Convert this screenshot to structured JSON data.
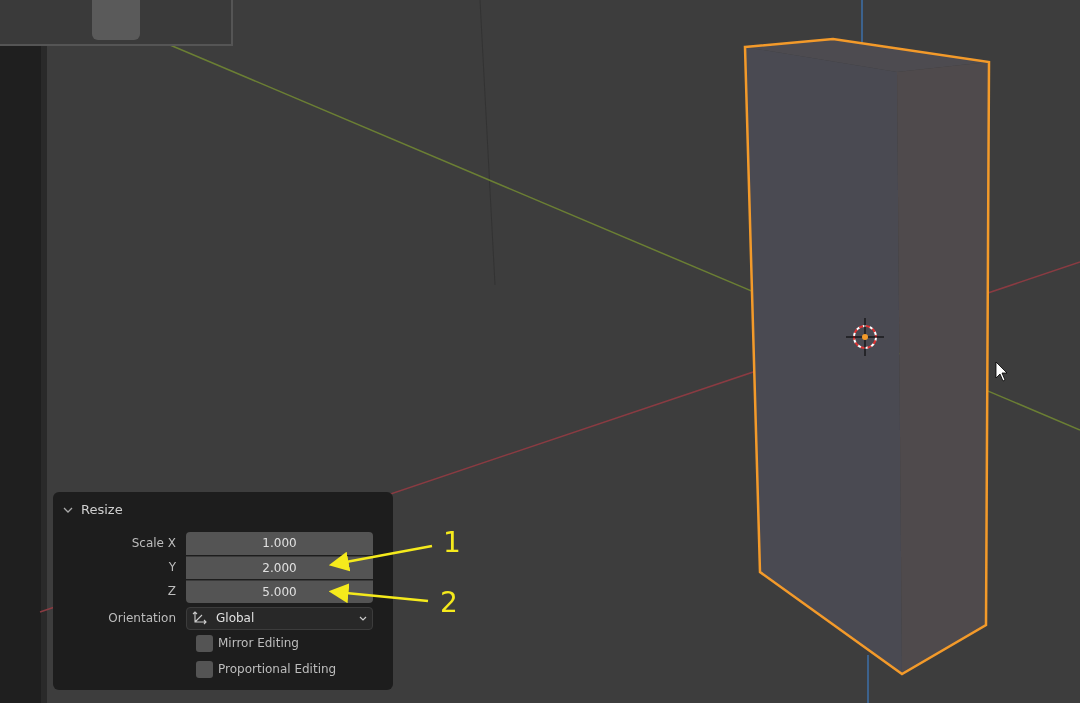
{
  "operator_panel": {
    "title": "Resize",
    "expanded": true,
    "fields": [
      {
        "label": "Scale X",
        "value": "1.000"
      },
      {
        "label": "Y",
        "value": "2.000"
      },
      {
        "label": "Z",
        "value": "5.000"
      }
    ],
    "orientation": {
      "label": "Orientation",
      "value": "Global"
    },
    "options": [
      {
        "label": "Mirror Editing",
        "checked": false
      },
      {
        "label": "Proportional Editing",
        "checked": false
      }
    ]
  },
  "annotations": [
    {
      "label": "1"
    },
    {
      "label": "2"
    }
  ]
}
